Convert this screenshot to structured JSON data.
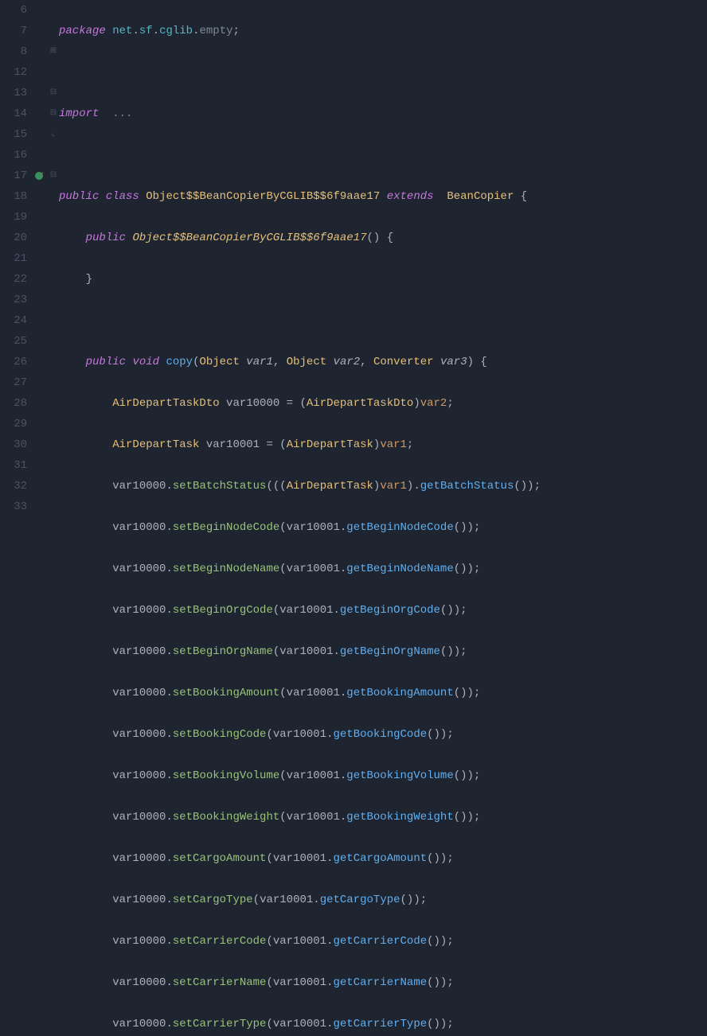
{
  "lines": [
    {
      "n": "6"
    },
    {
      "n": "7"
    },
    {
      "n": "8"
    },
    {
      "n": "12"
    },
    {
      "n": "13"
    },
    {
      "n": "14"
    },
    {
      "n": "15"
    },
    {
      "n": "16"
    },
    {
      "n": "17"
    },
    {
      "n": "18"
    },
    {
      "n": "19"
    },
    {
      "n": "20"
    },
    {
      "n": "21"
    },
    {
      "n": "22"
    },
    {
      "n": "23"
    },
    {
      "n": "24"
    },
    {
      "n": "25"
    },
    {
      "n": "26"
    },
    {
      "n": "27"
    },
    {
      "n": "28"
    },
    {
      "n": "29"
    },
    {
      "n": "30"
    },
    {
      "n": "31"
    },
    {
      "n": "32"
    },
    {
      "n": "33"
    }
  ],
  "kw": {
    "package": "package",
    "import": "import",
    "public": "public",
    "class": "class",
    "extends": "extends",
    "void": "void"
  },
  "pkg": {
    "net": "net",
    "sf": "sf",
    "cglib": "cglib",
    "empty": "empty"
  },
  "dots": "...",
  "className": "Object$$BeanCopierByCGLIB$$6f9aae17",
  "superName": "BeanCopier",
  "method": {
    "copy": "copy",
    "Object": "Object",
    "Converter": "Converter",
    "var1": "var1",
    "var2": "var2",
    "var3": "var3"
  },
  "types": {
    "AirDepartTaskDto": "AirDepartTaskDto",
    "AirDepartTask": "AirDepartTask"
  },
  "vars": {
    "var10000": "var10000",
    "var10001": "var10001",
    "var1": "var1",
    "var2": "var2"
  },
  "calls": [
    {
      "set": "setBatchStatus",
      "get": "getBatchStatus",
      "cast": true
    },
    {
      "set": "setBeginNodeCode",
      "get": "getBeginNodeCode"
    },
    {
      "set": "setBeginNodeName",
      "get": "getBeginNodeName"
    },
    {
      "set": "setBeginOrgCode",
      "get": "getBeginOrgCode"
    },
    {
      "set": "setBeginOrgName",
      "get": "getBeginOrgName"
    },
    {
      "set": "setBookingAmount",
      "get": "getBookingAmount"
    },
    {
      "set": "setBookingCode",
      "get": "getBookingCode"
    },
    {
      "set": "setBookingVolume",
      "get": "getBookingVolume"
    },
    {
      "set": "setBookingWeight",
      "get": "getBookingWeight"
    },
    {
      "set": "setCargoAmount",
      "get": "getCargoAmount"
    },
    {
      "set": "setCargoType",
      "get": "getCargoType"
    },
    {
      "set": "setCarrierCode",
      "get": "getCarrierCode"
    },
    {
      "set": "setCarrierName",
      "get": "getCarrierName"
    },
    {
      "set": "setCarrierType",
      "get": "getCarrierType"
    }
  ]
}
